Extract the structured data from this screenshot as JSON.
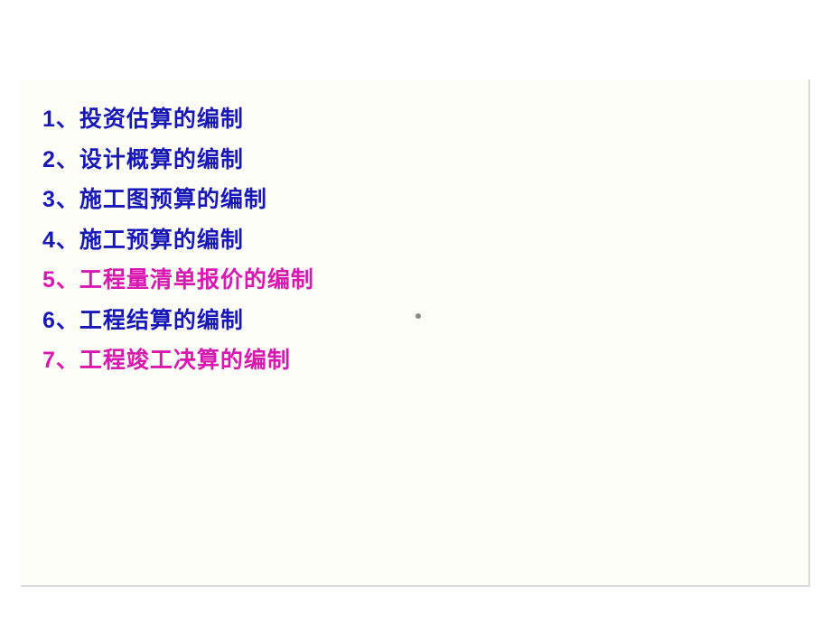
{
  "list_items": [
    {
      "text": "1、投资估算的编制",
      "color": "blue"
    },
    {
      "text": "2、设计概算的编制",
      "color": "blue"
    },
    {
      "text": "3、施工图预算的编制",
      "color": "blue"
    },
    {
      "text": "4、施工预算的编制",
      "color": "blue"
    },
    {
      "text": "5、工程量清单报价的编制",
      "color": "magenta"
    },
    {
      "text": "6、工程结算的编制",
      "color": "blue"
    },
    {
      "text": "7、工程竣工决算的编制",
      "color": "magenta"
    }
  ]
}
